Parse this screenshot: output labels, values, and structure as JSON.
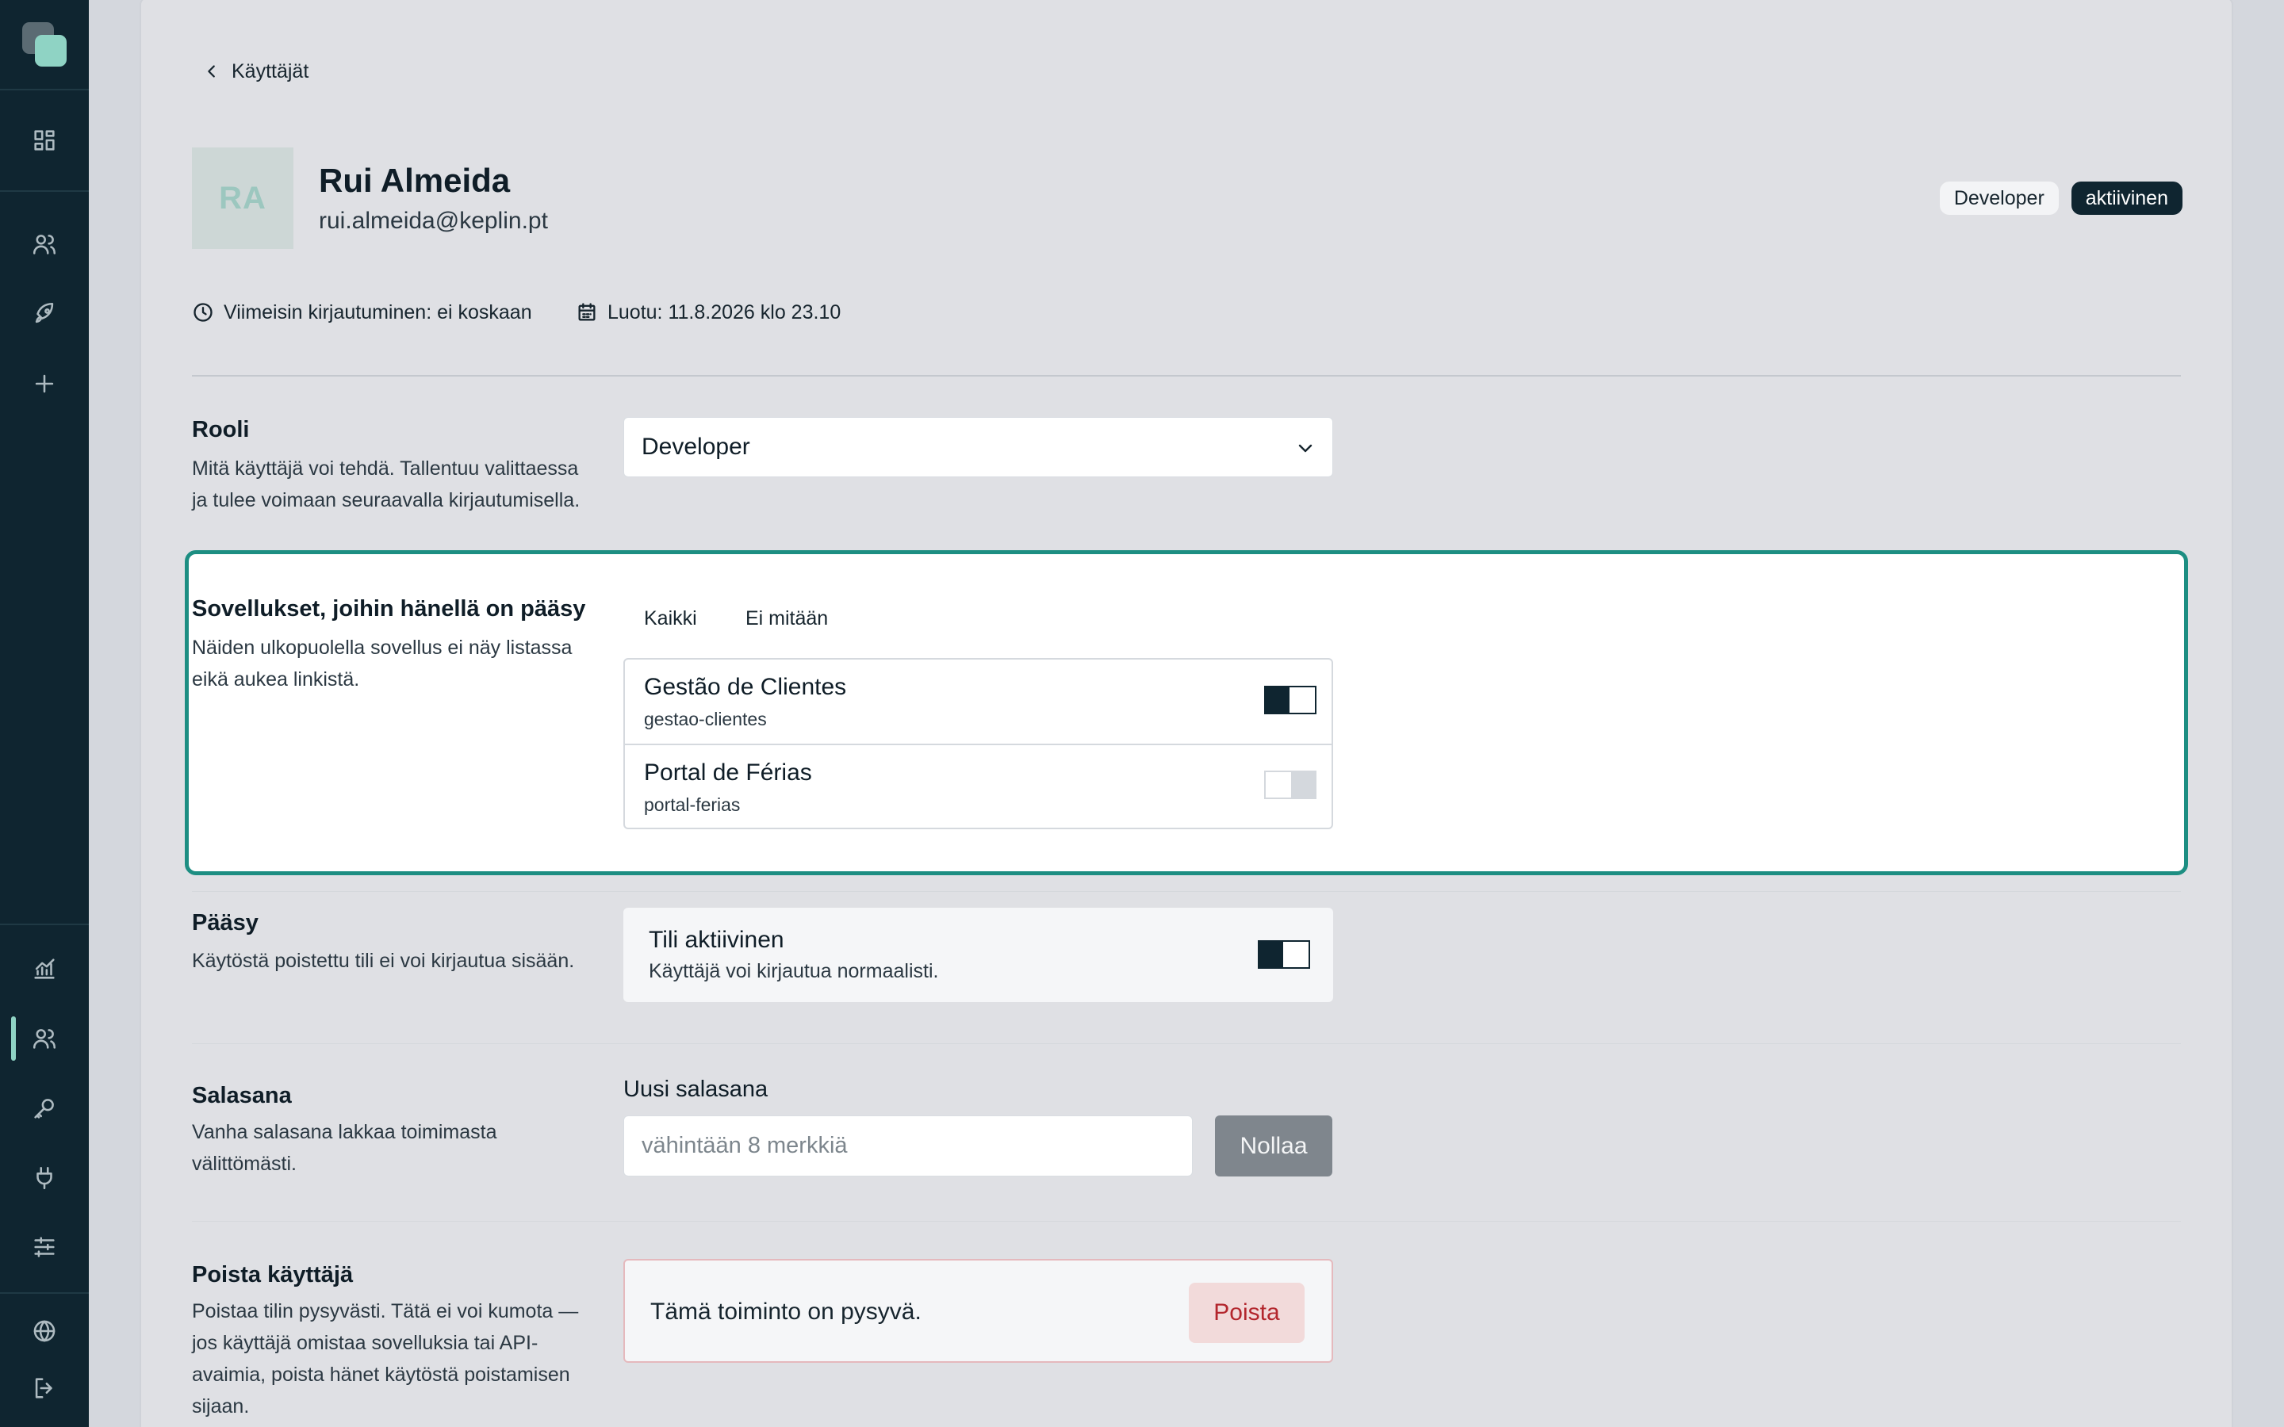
{
  "sidebar": {
    "icons": [
      "dashboard-icon",
      "users-icon",
      "rocket-icon",
      "plus-icon",
      "chart-icon",
      "users-icon",
      "key-icon",
      "plug-icon",
      "sliders-icon",
      "globe-icon",
      "logout-icon"
    ],
    "active_item": "users"
  },
  "nav": {
    "back_label": "Käyttäjät"
  },
  "user": {
    "initials": "RA",
    "name": "Rui Almeida",
    "email": "rui.almeida@keplin.pt",
    "role_badge": "Developer",
    "status_badge": "aktiivinen",
    "last_login": "Viimeisin kirjautuminen: ei koskaan",
    "created": "Luotu: 11.8.2026 klo 23.10"
  },
  "role_section": {
    "title": "Rooli",
    "description": "Mitä käyttäjä voi tehdä. Tallentuu valittaessa ja tulee voimaan seuraavalla kirjautumisella.",
    "selected": "Developer"
  },
  "apps_section": {
    "title": "Sovellukset, joihin hänellä on pääsy",
    "description": "Näiden ulkopuolella sovellus ei näy listassa eikä aukea linkistä.",
    "select_all_label": "Kaikki",
    "select_none_label": "Ei mitään",
    "apps": [
      {
        "name": "Gestão de Clientes",
        "slug": "gestao-clientes",
        "enabled": true
      },
      {
        "name": "Portal de Férias",
        "slug": "portal-ferias",
        "enabled": false
      }
    ]
  },
  "access_section": {
    "title": "Pääsy",
    "description": "Käytöstä poistettu tili ei voi kirjautua sisään.",
    "card_title": "Tili aktiivinen",
    "card_description": "Käyttäjä voi kirjautua normaalisti.",
    "enabled": true
  },
  "password_section": {
    "title": "Salasana",
    "description": "Vanha salasana lakkaa toimimasta välittömästi.",
    "field_label": "Uusi salasana",
    "placeholder": "vähintään 8 merkkiä",
    "value": "",
    "reset_label": "Nollaa"
  },
  "delete_section": {
    "title": "Poista käyttäjä",
    "description": "Poistaa tilin pysyvästi. Tätä ei voi kumota — jos käyttäjä omistaa sovelluksia tai API-avaimia, poista hänet käytöstä poistamisen sijaan.",
    "warning": "Tämä toiminto on pysyvä.",
    "delete_label": "Poista"
  },
  "colors": {
    "sidebar_bg": "#0f2530",
    "accent": "#8fd3c4",
    "highlight_border": "#1d8e82",
    "danger": "#b3262d"
  }
}
